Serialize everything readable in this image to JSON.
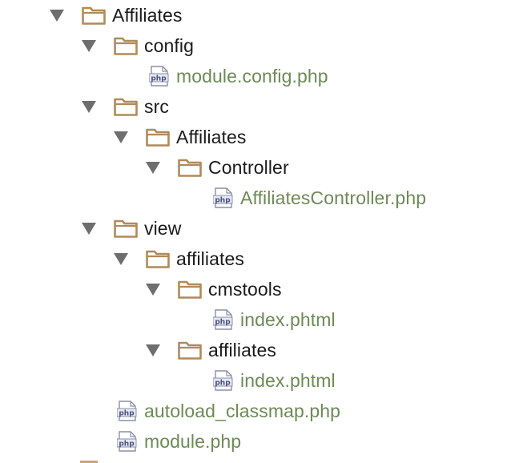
{
  "tree": [
    {
      "label": "Affiliates",
      "type": "folder",
      "depth": 0,
      "expanded": true
    },
    {
      "label": "config",
      "type": "folder",
      "depth": 1,
      "expanded": true
    },
    {
      "label": "module.config.php",
      "type": "php",
      "depth": 2
    },
    {
      "label": "src",
      "type": "folder",
      "depth": 1,
      "expanded": true
    },
    {
      "label": "Affiliates",
      "type": "folder",
      "depth": 2,
      "expanded": true
    },
    {
      "label": "Controller",
      "type": "folder",
      "depth": 3,
      "expanded": true
    },
    {
      "label": "AffiliatesController.php",
      "type": "php",
      "depth": 4
    },
    {
      "label": "view",
      "type": "folder",
      "depth": 1,
      "expanded": true
    },
    {
      "label": "affiliates",
      "type": "folder",
      "depth": 2,
      "expanded": true
    },
    {
      "label": "cmstools",
      "type": "folder",
      "depth": 3,
      "expanded": true
    },
    {
      "label": "index.phtml",
      "type": "php",
      "depth": 4
    },
    {
      "label": "affiliates",
      "type": "folder",
      "depth": 3,
      "expanded": true
    },
    {
      "label": "index.phtml",
      "type": "php",
      "depth": 4
    },
    {
      "label": "autoload_classmap.php",
      "type": "php",
      "depth": 1
    },
    {
      "label": "module.php",
      "type": "php",
      "depth": 1
    }
  ],
  "icons": {
    "folder": "folder-icon",
    "php": "php-file-icon",
    "arrow": "expand-arrow-icon",
    "php_text": "php"
  },
  "colors": {
    "folder_outline": "#b08a5c",
    "folder_fill": "#f3e9d2",
    "dir_text": "#1a1a1a",
    "file_text": "#6d8a55",
    "arrow": "#6e6e6e",
    "php_icon_border": "#8a8fa8",
    "php_icon_bg": "#e6e8f2",
    "php_icon_text": "#4a5080"
  }
}
